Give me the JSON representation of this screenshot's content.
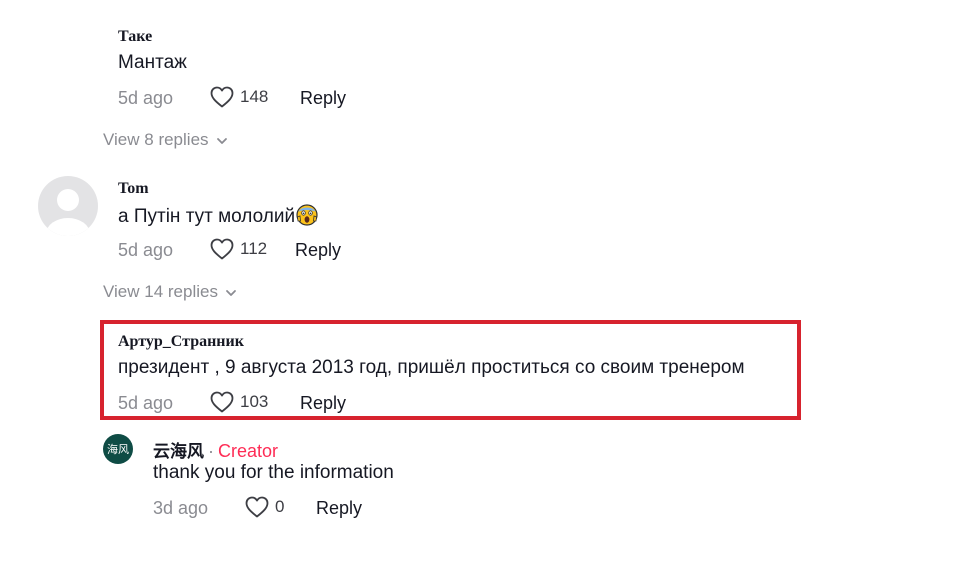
{
  "comments": [
    {
      "username": "Таке",
      "text": "Мантаж",
      "time": "5d ago",
      "likes": "148",
      "reply_label": "Reply",
      "view_replies": "View 8 replies"
    },
    {
      "username": "Tom",
      "text": "а Путін тут мололий",
      "emoji": "face-screaming-in-fear",
      "time": "5d ago",
      "likes": "112",
      "reply_label": "Reply",
      "view_replies": "View 14 replies"
    },
    {
      "username": "Артур_Странник",
      "text": "президент , 9 августа 2013 год, пришёл проститься со своим тренером",
      "time": "5d ago",
      "likes": "103",
      "reply_label": "Reply",
      "highlighted": true,
      "highlight_color": "#d7232e"
    }
  ],
  "creator_reply": {
    "avatar_text": "海风",
    "username": "云海风",
    "separator": "·",
    "badge": "Creator",
    "text": "thank you for the information",
    "time": "3d ago",
    "likes": "0",
    "reply_label": "Reply"
  },
  "colors": {
    "creator_badge": "#fe2c55",
    "muted": "#8a8b91",
    "text": "#161823",
    "avatar_brand": "#0f4c45"
  },
  "icons": {
    "like": "heart-outline-icon",
    "expand": "chevron-down-icon",
    "avatar_placeholder": "person-silhouette-icon"
  }
}
